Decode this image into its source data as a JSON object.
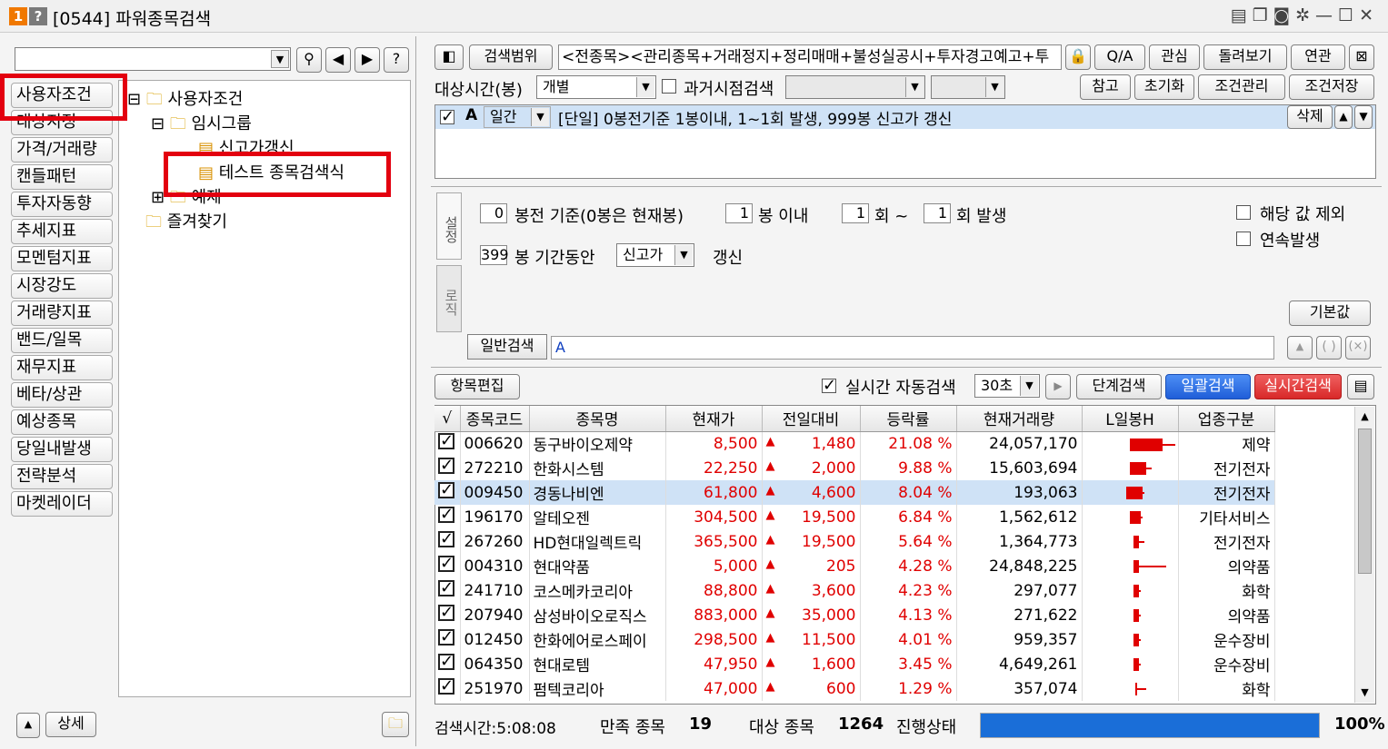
{
  "title": {
    "badge1": "1",
    "badge2": "?",
    "text": "[0544] 파워종목검색"
  },
  "left": {
    "search_value": "",
    "sidebar": [
      "사용자조건",
      "대상지정",
      "가격/거래량",
      "캔들패턴",
      "투자자동향",
      "추세지표",
      "모멘텀지표",
      "시장강도",
      "거래량지표",
      "밴드/일목",
      "재무지표",
      "베타/상관",
      "예상종목",
      "당일내발생",
      "전략분석",
      "마켓레이더"
    ],
    "tree": {
      "root": "사용자조건",
      "group": "임시그룹",
      "item1": "신고가갱신",
      "item2": "테스트 종목검색식",
      "item3": "예제",
      "fav": "즐겨찾기"
    },
    "detail_btn": "상세"
  },
  "top": {
    "search_range_btn": "검색범위",
    "range_text": "<전종목><관리종목+거래정지+정리매매+불성실공시+투자경고예고+투",
    "qa_btn": "Q/A",
    "interest_btn": "관심",
    "rotate_btn": "돌려보기",
    "related_btn": "연관",
    "target_time_label": "대상시간(봉)",
    "target_time_value": "개별",
    "past_search_label": "과거시점검색",
    "ref_btn": "참고",
    "reset_btn": "초기화",
    "cond_manage_btn": "조건관리",
    "cond_save_btn": "조건저장",
    "condition_letter": "A",
    "condition_period": "일간",
    "condition_text": "[단일] 0봉전기준 1봉이내, 1~1회 발생, 999봉 신고가 갱신",
    "delete_btn": "삭제"
  },
  "setup": {
    "tab_setting": "설정",
    "tab_logic": "로직",
    "v_bong": "0",
    "t_bong": "봉전 기준(0봉은 현재봉)",
    "v_within": "1",
    "t_within": "봉 이내",
    "v_from": "1",
    "t_from": "회 ~",
    "v_to": "1",
    "t_to": "회 발생",
    "v_period": "399",
    "t_period": "봉 기간동안",
    "sel_type": "신고가",
    "t_update": "갱신",
    "excl_label": "해당 값 제외",
    "cont_label": "연속발생",
    "default_btn": "기본값",
    "general_btn": "일반검색",
    "general_value": "A"
  },
  "bar": {
    "edit_btn": "항목편집",
    "auto_label": "실시간 자동검색",
    "interval": "30초",
    "step_btn": "단계검색",
    "batch_btn": "일괄검색",
    "realtime_btn": "실시간검색"
  },
  "table": {
    "headers": [
      "√",
      "종목코드",
      "종목명",
      "현재가",
      "전일대비",
      "등락률",
      "현재거래량",
      "L일봉H",
      "업종구분"
    ],
    "rows": [
      {
        "code": "006620",
        "name": "동구바이오제약",
        "price": "8,500",
        "diff": "1,480",
        "rate": "21.08 %",
        "vol": "24,057,170",
        "sector": "제약"
      },
      {
        "code": "272210",
        "name": "한화시스템",
        "price": "22,250",
        "diff": "2,000",
        "rate": "9.88 %",
        "vol": "15,603,694",
        "sector": "전기전자"
      },
      {
        "code": "009450",
        "name": "경동나비엔",
        "price": "61,800",
        "diff": "4,600",
        "rate": "8.04 %",
        "vol": "193,063",
        "sector": "전기전자"
      },
      {
        "code": "196170",
        "name": "알테오젠",
        "price": "304,500",
        "diff": "19,500",
        "rate": "6.84 %",
        "vol": "1,562,612",
        "sector": "기타서비스"
      },
      {
        "code": "267260",
        "name": "HD현대일렉트릭",
        "price": "365,500",
        "diff": "19,500",
        "rate": "5.64 %",
        "vol": "1,364,773",
        "sector": "전기전자"
      },
      {
        "code": "004310",
        "name": "현대약품",
        "price": "5,000",
        "diff": "205",
        "rate": "4.28 %",
        "vol": "24,848,225",
        "sector": "의약품"
      },
      {
        "code": "241710",
        "name": "코스메카코리아",
        "price": "88,800",
        "diff": "3,600",
        "rate": "4.23 %",
        "vol": "297,077",
        "sector": "화학"
      },
      {
        "code": "207940",
        "name": "삼성바이오로직스",
        "price": "883,000",
        "diff": "35,000",
        "rate": "4.13 %",
        "vol": "271,622",
        "sector": "의약품"
      },
      {
        "code": "012450",
        "name": "한화에어로스페이",
        "price": "298,500",
        "diff": "11,500",
        "rate": "4.01 %",
        "vol": "959,357",
        "sector": "운수장비"
      },
      {
        "code": "064350",
        "name": "현대로템",
        "price": "47,950",
        "diff": "1,600",
        "rate": "3.45 %",
        "vol": "4,649,261",
        "sector": "운수장비"
      },
      {
        "code": "251970",
        "name": "펌텍코리아",
        "price": "47,000",
        "diff": "600",
        "rate": "1.29 %",
        "vol": "357,074",
        "sector": "화학"
      }
    ]
  },
  "status": {
    "time_label": "검색시간:5:08:08",
    "match_label": "만족 종목",
    "match_count": "19",
    "target_label": "대상 종목",
    "target_count": "1264",
    "progress_label": "진행상태",
    "progress_pct": "100%",
    "progress_value": 1.0
  }
}
